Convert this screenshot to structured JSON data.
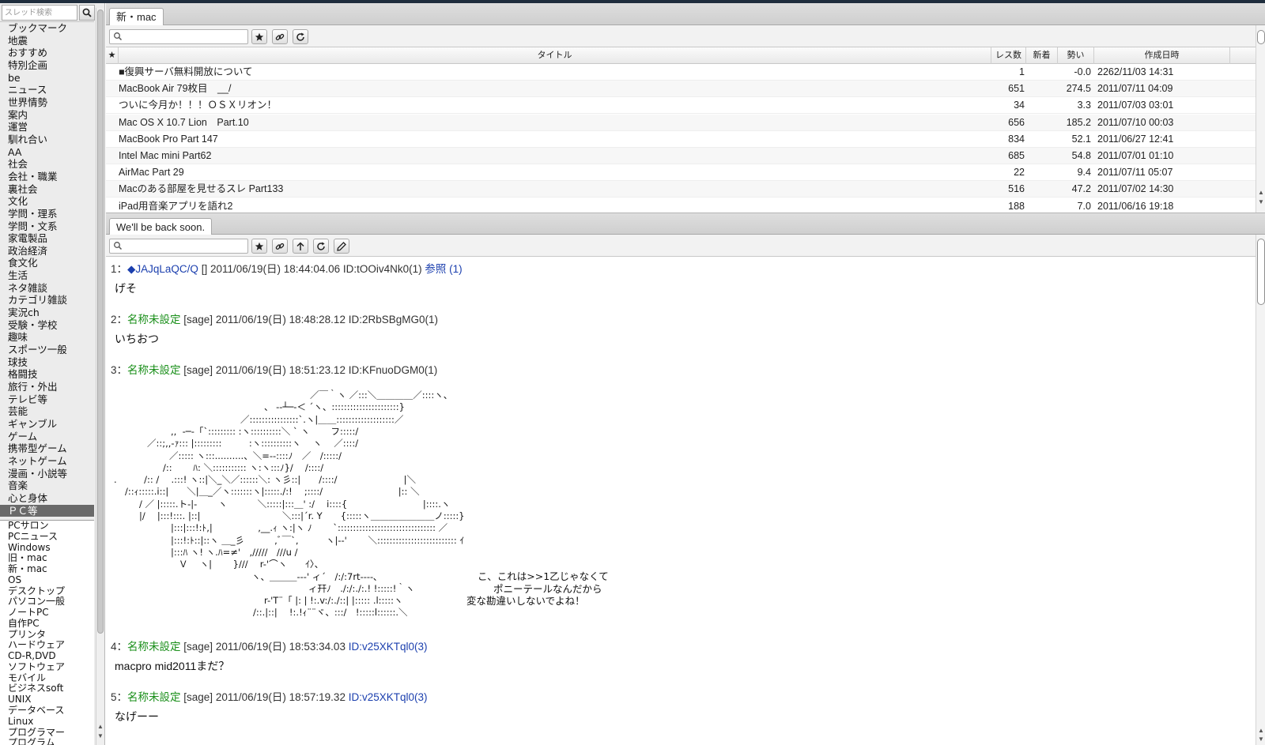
{
  "sidebar": {
    "search_placeholder": "スレッド検索",
    "categories": [
      "ブックマーク",
      "地震",
      "おすすめ",
      "特別企画",
      "be",
      "ニュース",
      "世界情勢",
      "案内",
      "運営",
      "馴れ合い",
      "AA",
      "社会",
      "会社・職業",
      "裏社会",
      "文化",
      "学問・理系",
      "学問・文系",
      "家電製品",
      "政治経済",
      "食文化",
      "生活",
      "ネタ雑談",
      "カテゴリ雑談",
      "実況ch",
      "受験・学校",
      "趣味",
      "スポーツ一般",
      "球技",
      "格闘技",
      "旅行・外出",
      "テレビ等",
      "芸能",
      "ギャンブル",
      "ゲーム",
      "携帯型ゲーム",
      "ネットゲーム",
      "漫画・小説等",
      "音楽",
      "心と身体",
      "ＰＣ等"
    ],
    "selected_category": "ＰＣ等",
    "boards": [
      "PCサロン",
      "PCニュース",
      "Windows",
      "旧・mac",
      "新・mac",
      "OS",
      "デスクトップ",
      "パソコン一般",
      "ノートPC",
      "自作PC",
      "プリンタ",
      "ハードウェア",
      "CD-R,DVD",
      "ソフトウェア",
      "モバイル",
      "ビジネスsoft",
      "UNIX",
      "データベース",
      "Linux",
      "プログラマー",
      "プログラム"
    ]
  },
  "thread_list": {
    "tab_label": "新・mac",
    "headers": {
      "mark": "★",
      "title": "タイトル",
      "res": "レス数",
      "new": "新着",
      "ikioi": "勢い",
      "date": "作成日時"
    },
    "rows": [
      {
        "title": "■復興サーバ無料開放について",
        "res": "1",
        "new": "",
        "ikioi": "-0.0",
        "date": "2262/11/03 14:31"
      },
      {
        "title": "MacBook Air 79枚目　__/",
        "res": "651",
        "new": "",
        "ikioi": "274.5",
        "date": "2011/07/11 04:09"
      },
      {
        "title": "ついに今月か！！！ＯＳＸリオン！",
        "res": "34",
        "new": "",
        "ikioi": "3.3",
        "date": "2011/07/03 03:01"
      },
      {
        "title": "Mac OS X 10.7 Lion　Part.10",
        "res": "656",
        "new": "",
        "ikioi": "185.2",
        "date": "2011/07/10 00:03"
      },
      {
        "title": "MacBook Pro Part 147",
        "res": "834",
        "new": "",
        "ikioi": "52.1",
        "date": "2011/06/27 12:41"
      },
      {
        "title": "Intel Mac mini Part62",
        "res": "685",
        "new": "",
        "ikioi": "54.8",
        "date": "2011/07/01 01:10"
      },
      {
        "title": "AirMac Part 29",
        "res": "22",
        "new": "",
        "ikioi": "9.4",
        "date": "2011/07/11 05:07"
      },
      {
        "title": "Macのある部屋を見せるスレ Part133",
        "res": "516",
        "new": "",
        "ikioi": "47.2",
        "date": "2011/07/02 14:30"
      },
      {
        "title": "iPad用音楽アプリを語れ2",
        "res": "188",
        "new": "",
        "ikioi": "7.0",
        "date": "2011/06/16 19:18"
      }
    ]
  },
  "thread_view": {
    "tab_label": "We'll be back soon.",
    "posts": [
      {
        "num": "1：",
        "name": "◆JAJqLaQC/Q",
        "mail": "[]",
        "datetime": "2011/06/19(日) 18:44:04.06",
        "id": "ID:tOOiv4Nk0(1)",
        "extra": "参照 (1)",
        "body": "げそ"
      },
      {
        "num": "2：",
        "name": "名称未設定",
        "mail": "[sage]",
        "datetime": "2011/06/19(日) 18:48:28.12",
        "id": "ID:2RbSBgMG0(1)",
        "body": "いちおつ"
      },
      {
        "num": "3：",
        "name": "名称未設定",
        "mail": "[sage]",
        "datetime": "2011/06/19(日) 18:51:23.12",
        "id": "ID:KFnuoDGM0(1)"
      },
      {
        "num": "4：",
        "name": "名称未設定",
        "mail": "[sage]",
        "datetime": "2011/06/19(日) 18:53:34.03",
        "id": "ID:v25XKTql0(3)",
        "body": "macpro mid2011まだ？"
      },
      {
        "num": "5：",
        "name": "名称未設定",
        "mail": "[sage]",
        "datetime": "2011/06/19(日) 18:57:19.32",
        "id": "ID:v25XKTql0(3)",
        "body": "なげーー"
      }
    ],
    "aa_lines": [
      "／￣｀ヽ ／:::＼＿＿＿＿／::::ヽ、",
      "、 --┴─-＜ ´ヽ、::::::::::::::::::::::}",
      "／::::::::::::::::`.ヽ|＿＿:::::::::::::::::::／",
      ",,  -─‐「`::::::::: :ヽ::::::::::＼ ` ヽ　　 フ:::::/",
      "／::;,,-ｧ::: |:::::::::　　　:ヽ::::::::::ヽ　 ヽ　 ／::::/",
      "／::::: ヽ:::..........、＼=--::::ﾉ　／　/:::::/",
      "/::　　 ﾊ: ＼::::::::::: ヽ:ヽ:::ﾉ}/　 /::::/",
      ".　　　/:: /　 .:::! ヽ::|＼_＼／::::::＼: ヽ彡::|　　/::::/　　　　　　　 |＼",
      "/::ｨ:::::.i::|　　＼|＿_／ヽ:::::::ヽ|:::::./:!　 ;::::/　　　　　　　　 |:: ＼",
      "/ ／ |:::::.ト-|-　　 ヽ　　　 ＼:::::|:::＿' :/　 i::::{　　　　　　　　 |::::.ヽ",
      "|/　 |:::!:::. |::|　　　　　　　　　＼:::|´r. Y　　{:::::ヽ＿＿＿＿＿＿＿ノ:::::}",
      "|:::|:::!:ﾄ,|　　　　　,__.ｨ ヽ:|ヽ ﾉ　　 `:::::::::::::::::::::::::::::::: ／",
      "|:::!:ﾄ::|::ヽ ＿_彡　　　 ,ﾞ￣`,　　　ヽ|--'　　 ＼:::::::::::::::::::::::::: ｲ",
      "|:::ﾊ ヽ! ヽ.ﾊ=≠'　,/////　///u /",
      "Ｖ　 ヽ|　　 }///　 r-'⌒ヽ　　ｲ〉、",
      "ヽ、＿＿＿--‐' ィ´　/:/:7rt----､",
      "ィ幵ﾉ　./:/:./:.! !:::::!｀ヽ",
      "r-'T¨「 |: | !:.v:/:./::| |::::: .l:::::ヽ",
      "/::.|::|　 !:.!ｨ¨¨ヾ、:::/　!:::::l::::::.＼"
    ],
    "aa_caption": [
      "こ、これは>>1乙じゃなくて",
      "ポニーテールなんだから",
      "変な勘違いしないでよね！"
    ]
  },
  "colors": {
    "name_green": "#1a8f1a",
    "id_blue": "#1b3fae",
    "selected_bg": "#6a6a6a"
  },
  "icons": [
    "search-icon",
    "star-icon",
    "link-icon",
    "refresh-icon",
    "arrow-up-icon",
    "pencil-icon"
  ]
}
